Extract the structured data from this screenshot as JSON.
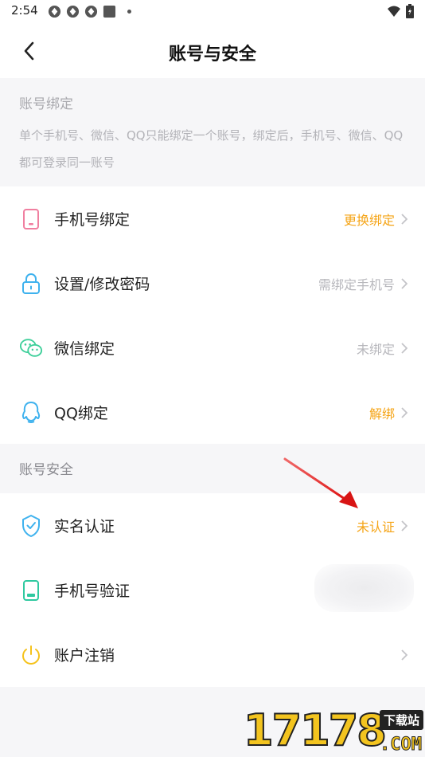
{
  "status_bar": {
    "time": "2:54",
    "icons": [
      "app-notification-icon",
      "app-notification-icon",
      "app-notification-icon",
      "app-square-icon",
      "dot-icon"
    ],
    "right_icons": [
      "wifi-icon",
      "battery-icon"
    ]
  },
  "header": {
    "title": "账号与安全"
  },
  "binding_section": {
    "title": "账号绑定",
    "description": "单个手机号、微信、QQ只能绑定一个账号，绑定后，手机号、微信、QQ都可登录同一账号"
  },
  "binding_items": [
    {
      "label": "手机号绑定",
      "status": "更换绑定",
      "status_color": "#f5a416",
      "icon": "phone-icon"
    },
    {
      "label": "设置/修改密码",
      "status": "需绑定手机号",
      "status_color": "#b7b7bc",
      "icon": "lock-icon"
    },
    {
      "label": "微信绑定",
      "status": "未绑定",
      "status_color": "#b7b7bc",
      "icon": "wechat-icon"
    },
    {
      "label": "QQ绑定",
      "status": "解绑",
      "status_color": "#f5a416",
      "icon": "qq-icon"
    }
  ],
  "security_section": {
    "title": "账号安全"
  },
  "security_items": [
    {
      "label": "实名认证",
      "status": "未认证",
      "status_color": "#f5a416",
      "icon": "shield-check-icon"
    },
    {
      "label": "手机号验证",
      "status": "",
      "icon": "phone-verify-icon"
    },
    {
      "label": "账户注销",
      "status": "",
      "icon": "power-icon"
    }
  ],
  "watermark": {
    "number": "17178",
    "tag": "下载站",
    "domain": ".COM"
  },
  "colors": {
    "accent_orange": "#f5a416",
    "muted_gray": "#b7b7bc",
    "background": "#f6f6f8"
  }
}
